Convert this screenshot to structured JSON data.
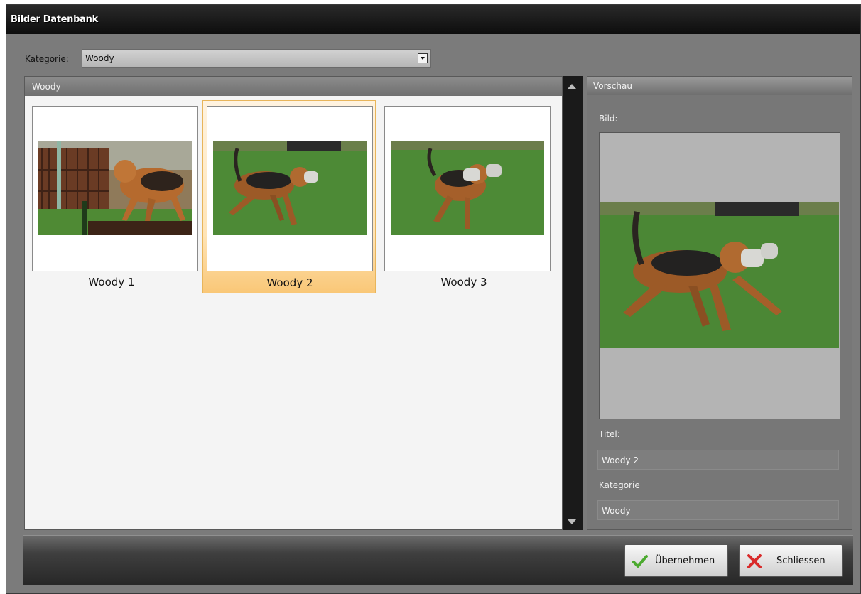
{
  "window": {
    "title": "Bilder Datenbank"
  },
  "category": {
    "label": "Kategorie:",
    "selected": "Woody"
  },
  "gallery": {
    "header": "Woody",
    "items": [
      {
        "caption": "Woody 1",
        "selected": false
      },
      {
        "caption": "Woody 2",
        "selected": true
      },
      {
        "caption": "Woody 3",
        "selected": false
      }
    ]
  },
  "preview": {
    "header": "Vorschau",
    "image_label": "Bild:",
    "title_label": "Titel:",
    "title_value": "Woody 2",
    "category_label": "Kategorie",
    "category_value": "Woody"
  },
  "buttons": {
    "apply": "Übernehmen",
    "close": "Schliessen"
  },
  "colors": {
    "selection": "#f9c777",
    "window_bg": "#7b7b7b",
    "title_bar": "#111111"
  },
  "icons": {
    "apply": "checkmark-icon",
    "close": "red-x-icon",
    "dropdown": "chevron-down-icon"
  }
}
